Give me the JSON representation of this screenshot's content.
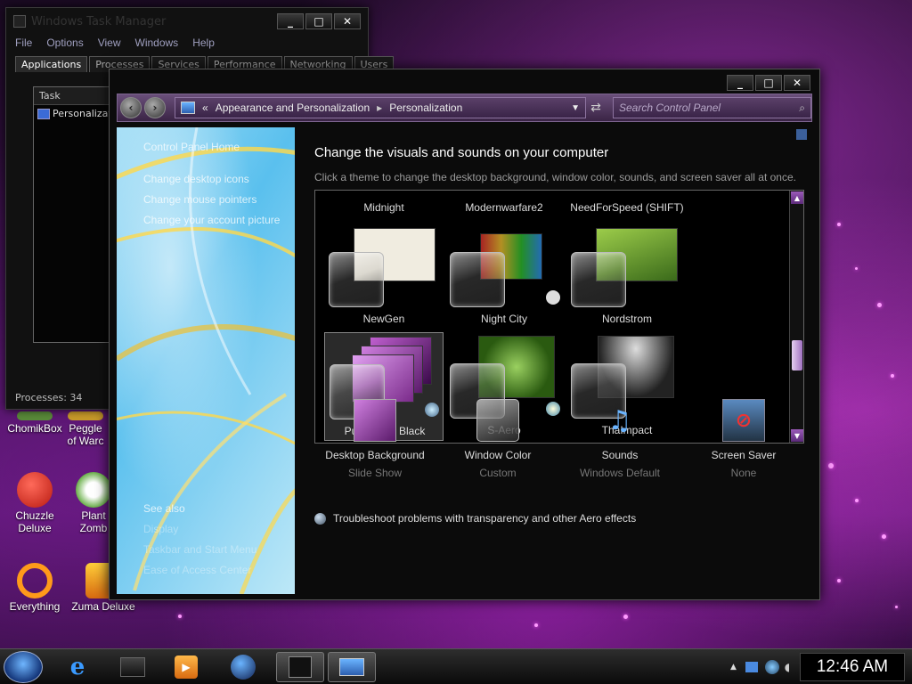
{
  "desktop": {
    "icons": [
      {
        "label": "ChomikBox"
      },
      {
        "label": "Peggle\nof Warc"
      },
      {
        "label": "Chuzzle\nDeluxe"
      },
      {
        "label": "Plant\nZomb"
      },
      {
        "label": "Everything"
      },
      {
        "label": "Zuma Deluxe"
      }
    ]
  },
  "task_manager": {
    "title": "Windows Task Manager",
    "menu": [
      "File",
      "Options",
      "View",
      "Windows",
      "Help"
    ],
    "tabs": [
      "Applications",
      "Processes",
      "Services",
      "Performance",
      "Networking",
      "Users"
    ],
    "active_tab": "Applications",
    "list_header": "Task",
    "rows": [
      "Personalizatio"
    ],
    "status": "Processes: 34"
  },
  "personalization": {
    "breadcrumb": [
      "Appearance and Personalization",
      "Personalization"
    ],
    "search_placeholder": "Search Control Panel",
    "left_links": [
      "Control Panel Home",
      "Change desktop icons",
      "Change mouse pointers",
      "Change your account picture"
    ],
    "see_also_title": "See also",
    "see_also_links": [
      "Display",
      "Taskbar and Start Menu",
      "Ease of Access Center"
    ],
    "title": "Change the visuals and sounds on your computer",
    "subtitle": "Click a theme to change the desktop background, window color, sounds, and screen saver all at once.",
    "themes": [
      {
        "name": "Midnight"
      },
      {
        "name": "Modernwarfare2"
      },
      {
        "name": "NeedForSpeed (SHIFT)"
      },
      {
        "name": "NewGen"
      },
      {
        "name": "Night City"
      },
      {
        "name": "Nordstrom"
      },
      {
        "name": "Purple and Black",
        "selected": true
      },
      {
        "name": "S-Aero"
      },
      {
        "name": "ThaImpact"
      }
    ],
    "bottom": [
      {
        "title": "Desktop Background",
        "value": "Slide Show",
        "icon": "desktop-background-icon"
      },
      {
        "title": "Window Color",
        "value": "Custom",
        "icon": "window-color-icon"
      },
      {
        "title": "Sounds",
        "value": "Windows Default",
        "icon": "sounds-icon"
      },
      {
        "title": "Screen Saver",
        "value": "None",
        "icon": "screen-saver-icon"
      }
    ],
    "troubleshoot": "Troubleshoot problems with transparency and other Aero effects"
  },
  "caption_buttons": {
    "minimize": "_",
    "maximize": "□",
    "close": "✕"
  },
  "taskbar": {
    "clock": "12:46 AM"
  },
  "colors": {
    "accent": "#7d4fa0",
    "selection": "#888888",
    "wallpaper": "#5a1670"
  }
}
